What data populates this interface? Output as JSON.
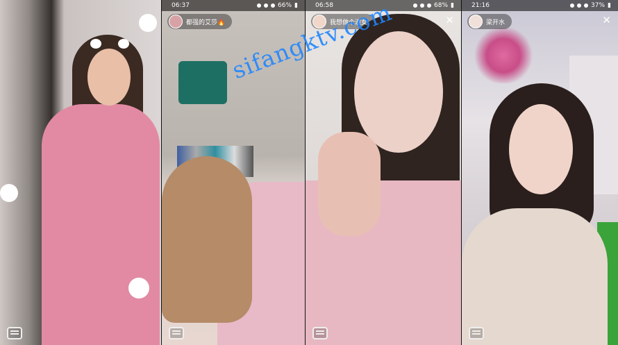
{
  "watermark": "sifangktv.com",
  "panels": [
    {
      "id": "panel-1",
      "has_status": false,
      "has_pill": false
    },
    {
      "id": "panel-2",
      "has_status": true,
      "status": {
        "time": "06:37",
        "battery": "66%"
      },
      "streamer": {
        "name": "都强的艾莎🔥"
      },
      "has_close": false
    },
    {
      "id": "panel-3",
      "has_status": true,
      "status": {
        "time": "06:58",
        "battery": "68%"
      },
      "streamer": {
        "name": "我想做个淑女"
      },
      "has_close": true,
      "close_glyph": "✕"
    },
    {
      "id": "panel-4",
      "has_status": true,
      "status": {
        "time": "21:16",
        "battery": "37%"
      },
      "streamer": {
        "name": "梁开水"
      },
      "has_close": true,
      "close_glyph": "✕"
    }
  ]
}
